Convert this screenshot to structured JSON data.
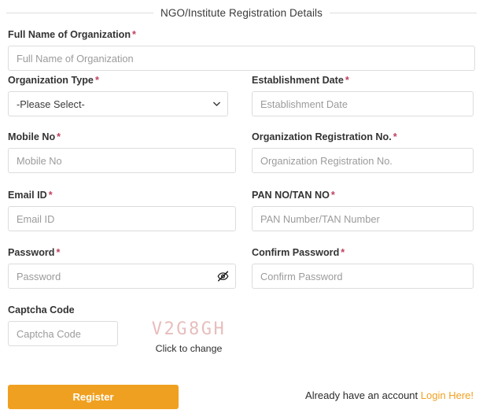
{
  "header": {
    "title": "NGO/Institute Registration Details"
  },
  "colors": {
    "accent": "#f0a020",
    "required_asterisk": "#c0415f",
    "label": "#333333",
    "placeholder": "#9b9b9b",
    "border": "#dcdcdc",
    "rule": "#dedede",
    "captcha_text": "#e8bdbd"
  },
  "required_marker": "*",
  "fields": {
    "full_name": {
      "label": "Full Name of Organization",
      "placeholder": "Full Name of Organization",
      "value": "",
      "required": true
    },
    "org_type": {
      "label": "Organization Type",
      "selected": "-Please Select-",
      "required": true,
      "options": [
        "-Please Select-"
      ]
    },
    "establishment_date": {
      "label": "Establishment Date",
      "placeholder": "Establishment Date",
      "value": "",
      "required": true
    },
    "mobile_no": {
      "label": "Mobile No",
      "placeholder": "Mobile No",
      "value": "",
      "required": true
    },
    "org_registration_no": {
      "label": "Organization Registration No.",
      "placeholder": "Organization Registration No.",
      "value": "",
      "required": true
    },
    "email_id": {
      "label": "Email ID",
      "placeholder": "Email ID",
      "value": "",
      "required": true
    },
    "pan_tan": {
      "label": "PAN NO/TAN NO",
      "placeholder": "PAN Number/TAN Number",
      "value": "",
      "required": true
    },
    "password": {
      "label": "Password",
      "placeholder": "Password",
      "value": "",
      "required": true,
      "toggle_icon": "eye-slash-icon",
      "visible": false
    },
    "confirm_password": {
      "label": "Confirm Password",
      "placeholder": "Confirm Password",
      "value": "",
      "required": true
    },
    "captcha": {
      "label": "Captcha Code",
      "placeholder": "Captcha Code",
      "value": "",
      "required": false,
      "code": "V2G8GH",
      "hint": "Click to change"
    }
  },
  "footer": {
    "register_label": "Register",
    "account_text": "Already have an account",
    "login_link": "Login Here!"
  },
  "icons": {
    "chevron_down": "chevron-down-icon",
    "eye_slash": "eye-slash-icon"
  }
}
